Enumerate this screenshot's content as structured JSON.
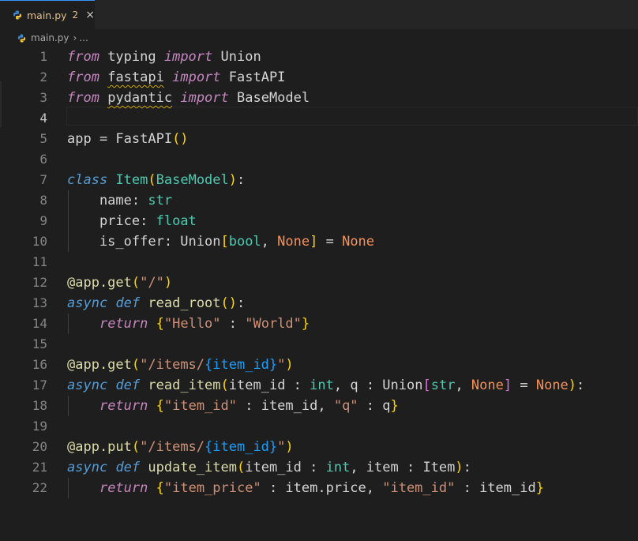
{
  "tab": {
    "filename": "main.py",
    "problem_count": "2",
    "close_glyph": "×",
    "icon": "python-icon"
  },
  "breadcrumb": {
    "file": "main.py",
    "separator": "›",
    "ellipsis": "..."
  },
  "editor": {
    "active_line": 4,
    "lines": [
      {
        "n": "1",
        "tokens": [
          [
            "from",
            "k"
          ],
          [
            " typing ",
            "n"
          ],
          [
            "import",
            "k"
          ],
          [
            " Union",
            "n"
          ]
        ]
      },
      {
        "n": "2",
        "tokens": [
          [
            "from",
            "k"
          ],
          [
            " ",
            "n"
          ],
          [
            "fastapi",
            "n squig"
          ],
          [
            " ",
            "n"
          ],
          [
            "import",
            "k"
          ],
          [
            " FastAPI",
            "n"
          ]
        ]
      },
      {
        "n": "3",
        "tokens": [
          [
            "from",
            "k"
          ],
          [
            " ",
            "n"
          ],
          [
            "pydantic",
            "n squig"
          ],
          [
            " ",
            "n"
          ],
          [
            "import",
            "k"
          ],
          [
            " BaseModel",
            "n"
          ]
        ]
      },
      {
        "n": "4",
        "tokens": []
      },
      {
        "n": "5",
        "tokens": [
          [
            "app = FastAPI",
            "n"
          ],
          [
            "()",
            "b1"
          ]
        ]
      },
      {
        "n": "6",
        "tokens": []
      },
      {
        "n": "7",
        "tokens": [
          [
            "class",
            "sk"
          ],
          [
            " ",
            "n"
          ],
          [
            "Item",
            "t"
          ],
          [
            "(",
            "b1"
          ],
          [
            "BaseModel",
            "t"
          ],
          [
            ")",
            "b1"
          ],
          [
            ":",
            "n"
          ]
        ]
      },
      {
        "n": "8",
        "tokens": [
          [
            "    name: ",
            "n"
          ],
          [
            "str",
            "t"
          ]
        ]
      },
      {
        "n": "9",
        "tokens": [
          [
            "    price: ",
            "n"
          ],
          [
            "float",
            "t"
          ]
        ]
      },
      {
        "n": "10",
        "tokens": [
          [
            "    is_offer: Union",
            "n"
          ],
          [
            "[",
            "b1"
          ],
          [
            "bool",
            "t"
          ],
          [
            ", ",
            "n"
          ],
          [
            "None",
            "o"
          ],
          [
            "]",
            "b1"
          ],
          [
            " = ",
            "n"
          ],
          [
            "None",
            "o"
          ]
        ]
      },
      {
        "n": "11",
        "tokens": []
      },
      {
        "n": "12",
        "tokens": [
          [
            "@app.get",
            "dc"
          ],
          [
            "(",
            "b1"
          ],
          [
            "\"/\"",
            "s"
          ],
          [
            ")",
            "b1"
          ]
        ]
      },
      {
        "n": "13",
        "tokens": [
          [
            "async",
            "sk"
          ],
          [
            " ",
            "n"
          ],
          [
            "def",
            "sk"
          ],
          [
            " ",
            "n"
          ],
          [
            "read_root",
            "f"
          ],
          [
            "()",
            "b1"
          ],
          [
            ":",
            "n"
          ]
        ]
      },
      {
        "n": "14",
        "tokens": [
          [
            "    ",
            "n"
          ],
          [
            "return",
            "k"
          ],
          [
            " ",
            "n"
          ],
          [
            "{",
            "b1"
          ],
          [
            "\"Hello\"",
            "s"
          ],
          [
            " : ",
            "n"
          ],
          [
            "\"World\"",
            "s"
          ],
          [
            "}",
            "b1"
          ]
        ]
      },
      {
        "n": "15",
        "tokens": []
      },
      {
        "n": "16",
        "tokens": [
          [
            "@app.get",
            "dc"
          ],
          [
            "(",
            "b1"
          ],
          [
            "\"/items/",
            "s"
          ],
          [
            "{item_id}",
            "b3"
          ],
          [
            "\"",
            "s"
          ],
          [
            ")",
            "b1"
          ]
        ]
      },
      {
        "n": "17",
        "tokens": [
          [
            "async",
            "sk"
          ],
          [
            " ",
            "n"
          ],
          [
            "def",
            "sk"
          ],
          [
            " ",
            "n"
          ],
          [
            "read_item",
            "f"
          ],
          [
            "(",
            "b1"
          ],
          [
            "item_id",
            "n"
          ],
          [
            " : ",
            "n"
          ],
          [
            "int",
            "t"
          ],
          [
            ", q : Union",
            "n"
          ],
          [
            "[",
            "b2"
          ],
          [
            "str",
            "t"
          ],
          [
            ", ",
            "n"
          ],
          [
            "None",
            "o"
          ],
          [
            "]",
            "b2"
          ],
          [
            " = ",
            "n"
          ],
          [
            "None",
            "o"
          ],
          [
            ")",
            "b1"
          ],
          [
            ":",
            "n"
          ]
        ]
      },
      {
        "n": "18",
        "tokens": [
          [
            "    ",
            "n"
          ],
          [
            "return",
            "k"
          ],
          [
            " ",
            "n"
          ],
          [
            "{",
            "b1"
          ],
          [
            "\"item_id\"",
            "s"
          ],
          [
            " : item_id, ",
            "n"
          ],
          [
            "\"q\"",
            "s"
          ],
          [
            " : q",
            "n"
          ],
          [
            "}",
            "b1"
          ]
        ]
      },
      {
        "n": "19",
        "tokens": []
      },
      {
        "n": "20",
        "tokens": [
          [
            "@app.put",
            "dc"
          ],
          [
            "(",
            "b1"
          ],
          [
            "\"/items/",
            "s"
          ],
          [
            "{item_id}",
            "b3"
          ],
          [
            "\"",
            "s"
          ],
          [
            ")",
            "b1"
          ]
        ]
      },
      {
        "n": "21",
        "tokens": [
          [
            "async",
            "sk"
          ],
          [
            " ",
            "n"
          ],
          [
            "def",
            "sk"
          ],
          [
            " ",
            "n"
          ],
          [
            "update_item",
            "f"
          ],
          [
            "(",
            "b1"
          ],
          [
            "item_id : ",
            "n"
          ],
          [
            "int",
            "t"
          ],
          [
            ", item : Item",
            "n"
          ],
          [
            ")",
            "b1"
          ],
          [
            ":",
            "n"
          ]
        ]
      },
      {
        "n": "22",
        "tokens": [
          [
            "    ",
            "n"
          ],
          [
            "return",
            "k"
          ],
          [
            " ",
            "n"
          ],
          [
            "{",
            "b1"
          ],
          [
            "\"item_price\"",
            "s"
          ],
          [
            " : item.price, ",
            "n"
          ],
          [
            "\"item_id\"",
            "s"
          ],
          [
            " : item_id",
            "n"
          ],
          [
            "}",
            "b1"
          ]
        ]
      }
    ]
  }
}
